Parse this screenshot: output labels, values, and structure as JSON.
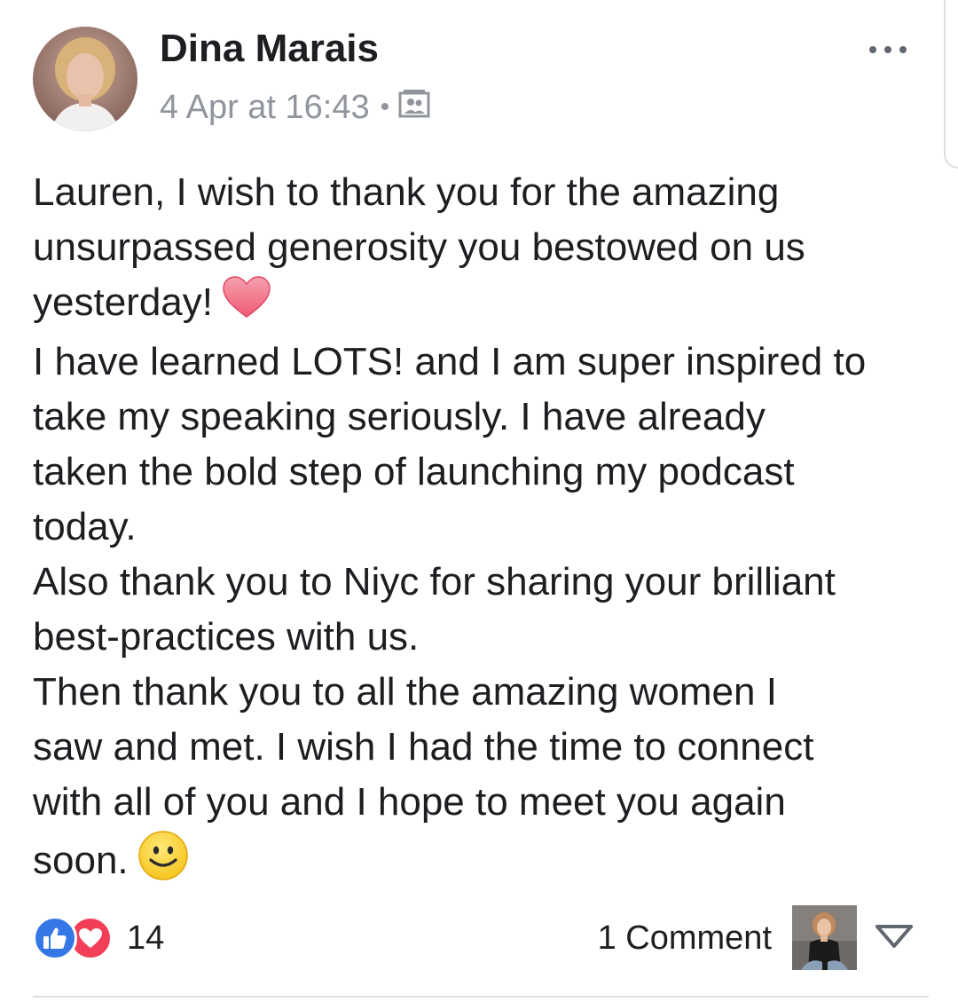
{
  "post": {
    "author_name": "Dina Marais",
    "timestamp": "4 Apr at 16:43",
    "separator": "•",
    "privacy_icon": "photo-album-icon",
    "more_icon": "more-options-icon",
    "body_lines": [
      "Lauren, I wish to thank you for the amazing",
      "unsurpassed generosity you bestowed on us",
      "yesterday!",
      "I have learned LOTS! and I am super inspired to",
      "take my speaking seriously. I have already",
      "taken the bold step of launching my podcast",
      "today.",
      "Also thank you to Niyc for sharing your brilliant",
      "best-practices with us.",
      "Then thank you to all the amazing women I",
      "saw and met. I wish I had the time to connect",
      "with all of you and I hope to meet you again",
      "soon."
    ],
    "emoji": [
      "heart-emoji",
      "smiley-emoji"
    ]
  },
  "footer": {
    "reaction_icons": [
      "like-reaction-icon",
      "love-reaction-icon"
    ],
    "reaction_count": "14",
    "comment_count": "1 Comment",
    "share_icon": "chevron-down-icon"
  },
  "colors": {
    "like_blue": "#3578e5",
    "love_red": "#f33e58",
    "meta_gray": "#90949c",
    "text": "#1c1e21"
  }
}
